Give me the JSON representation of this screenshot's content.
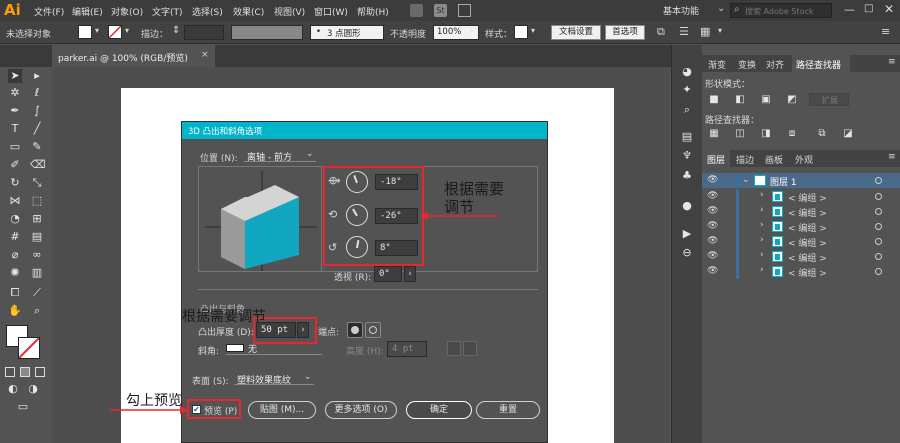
{
  "app": {
    "logo": "Ai"
  },
  "menu": {
    "items": [
      "文件(F)",
      "编辑(E)",
      "对象(O)",
      "文字(T)",
      "选择(S)",
      "效果(C)",
      "视图(V)",
      "窗口(W)",
      "帮助(H)"
    ],
    "workspace": "基本功能",
    "search_placeholder": "搜索 Adobe Stock"
  },
  "control_bar": {
    "selection": "未选择对象",
    "stroke_label": "描边：",
    "brush": "3 点圆形",
    "opacity_label": "不透明度",
    "opacity_value": "100%",
    "style_label": "样式：",
    "doc_settings": "文档设置",
    "preferences": "首选项"
  },
  "document_tab": {
    "title": "parker.ai @ 100% (RGB/预览)",
    "close": "×"
  },
  "right_panel": {
    "tabs": [
      "渐变",
      "变换",
      "对齐",
      "路径查找器"
    ],
    "shape_modes_label": "形状模式：",
    "expand_label": "扩展",
    "pathfinder_label": "路径查找器：",
    "layer_tabs": [
      "图层",
      "描边",
      "画板",
      "外观"
    ],
    "layer_name": "图层 1",
    "sublayers": [
      "< 编组 >",
      "< 编组 >",
      "< 编组 >",
      "< 编组 >",
      "< 编组 >",
      "< 编组 >"
    ]
  },
  "dialog": {
    "title": "3D 凸出和斜角选项",
    "position_label": "位置 (N):",
    "position_value": "离轴 - 前方",
    "rotate_x": "-18°",
    "rotate_y": "-26°",
    "rotate_z": "8°",
    "perspective_label": "透视 (R):",
    "perspective_value": "0°",
    "section_label": "凸出与斜角",
    "extrude_label": "凸出厚度 (D):",
    "extrude_value": "50 pt",
    "cap_label": "端点:",
    "bevel_label": "斜角:",
    "bevel_value": "无",
    "height_label": "高度 (H):",
    "height_value": "4 pt",
    "surface_label": "表面 (S):",
    "surface_value": "塑料效果底纹",
    "preview_label": "预览 (P)",
    "preview_checked": true,
    "map_button": "贴图 (M)...",
    "more_button": "更多选项 (O)",
    "ok_button": "确定",
    "reset_button": "重置"
  },
  "annotations": {
    "rotate_note_line1": "根据需要",
    "rotate_note_line2": "调节",
    "extrude_note": "根据需要调节",
    "preview_note": "勾上预览"
  },
  "colors": {
    "accent": "#00b4cc",
    "cube_front": "#11a7c0",
    "cube_side": "#9a9a9a",
    "cube_top": "#d4d4d4",
    "annotation_red": "#e8262d",
    "layer_blue": "#3a6ea5"
  }
}
